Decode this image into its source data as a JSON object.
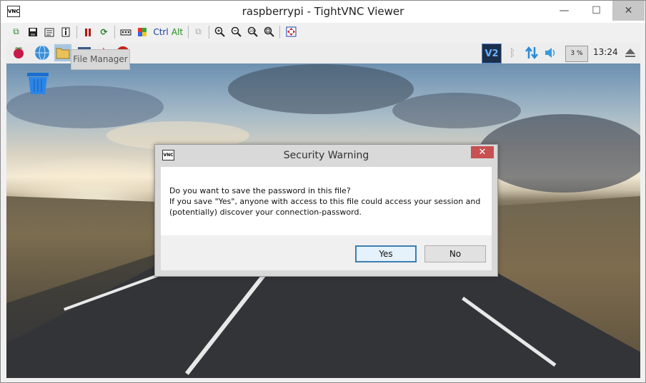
{
  "window": {
    "title": "raspberrypi - TightVNC Viewer",
    "icon": "vnc-icon",
    "icon_text": "VNC",
    "minimize": "—",
    "maximize": "☐",
    "close": "✕"
  },
  "toolbar": {
    "ctrl_label": "Ctrl",
    "alt_label": "Alt"
  },
  "panel": {
    "tooltip": "File Manager",
    "cpu": "3 %",
    "clock": "13:24",
    "vnc_badge": "V2"
  },
  "dialog": {
    "title": "Security Warning",
    "close": "✕",
    "message_line1": "Do you want to save the password in this file?",
    "message_line2": "If you save \"Yes\", anyone with access to this file could access your session and",
    "message_line3": "(potentially) discover your connection-password.",
    "yes_label": "Yes",
    "no_label": "No"
  },
  "colors": {
    "accent": "#3c7fb1",
    "close_red": "#c75050"
  }
}
